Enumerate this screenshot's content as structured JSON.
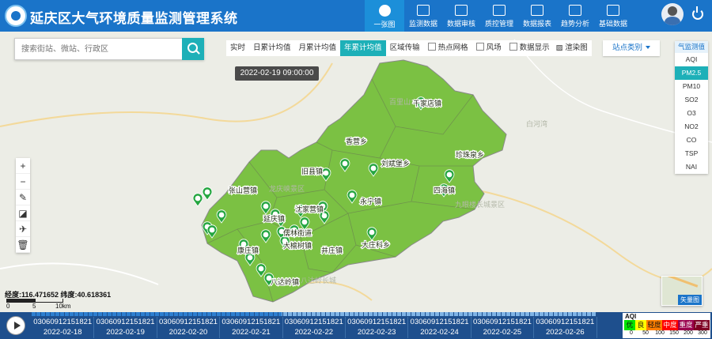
{
  "header": {
    "title": "延庆区大气环境质量监测管理系统",
    "nav": [
      {
        "label": "一张图",
        "icon": "globe-icon",
        "active": true
      },
      {
        "label": "监测数据",
        "icon": "monitor-icon"
      },
      {
        "label": "数据审核",
        "icon": "audit-icon"
      },
      {
        "label": "质控管理",
        "icon": "qc-icon"
      },
      {
        "label": "数据报表",
        "icon": "report-icon"
      },
      {
        "label": "趋势分析",
        "icon": "trend-icon"
      },
      {
        "label": "基础数据",
        "icon": "database-icon"
      }
    ]
  },
  "search": {
    "placeholder": "搜索街站、微站、行政区"
  },
  "toolbar": {
    "tabs": [
      "实时",
      "日累计均值",
      "月累计均值",
      "年累计均值"
    ],
    "active_tab": "年累计均值",
    "options": [
      "区域传输",
      "热点网格",
      "风场",
      "数据显示"
    ],
    "render_label": "渲染图",
    "site_type_label": "站点类别"
  },
  "pollutants": {
    "title": "气监测值",
    "items": [
      "AQI",
      "PM2.5",
      "PM10",
      "SO2",
      "O3",
      "NO2",
      "CO",
      "TSP",
      "NAI"
    ],
    "active": "PM2.5"
  },
  "map": {
    "datetime": "2022-02-19 09:00:00",
    "coords": "经度:116.471652 纬度:40.618361",
    "scale": {
      "zero": "0",
      "mid": "5",
      "end": "10km"
    },
    "minimap_label": "矢量图",
    "district_color": "#7bc143",
    "places": [
      {
        "name": "千家店镇"
      },
      {
        "name": "珍珠泉乡"
      },
      {
        "name": "香营乡"
      },
      {
        "name": "刘斌堡乡"
      },
      {
        "name": "旧县镇"
      },
      {
        "name": "四海镇"
      },
      {
        "name": "张山营镇"
      },
      {
        "name": "永宁镇"
      },
      {
        "name": "沈家营镇"
      },
      {
        "name": "延庆镇"
      },
      {
        "name": "儒林街道"
      },
      {
        "name": "大榆树镇"
      },
      {
        "name": "井庄镇"
      },
      {
        "name": "大庄科乡"
      },
      {
        "name": "康庄镇"
      },
      {
        "name": "八达岭镇"
      }
    ],
    "background_labels": [
      "白河湾",
      "九眼楼长城景区",
      "龙庆峡景区",
      "百里山水画廊",
      "八达岭长城"
    ]
  },
  "timeline": {
    "items": [
      {
        "code": "03060912151821",
        "date": "2022-02-18"
      },
      {
        "code": "03060912151821",
        "date": "2022-02-19"
      },
      {
        "code": "03060912151821",
        "date": "2022-02-20"
      },
      {
        "code": "03060912151821",
        "date": "2022-02-21"
      },
      {
        "code": "03060912151821",
        "date": "2022-02-22"
      },
      {
        "code": "03060912151821",
        "date": "2022-02-23"
      },
      {
        "code": "03060912151821",
        "date": "2022-02-24"
      },
      {
        "code": "03060912151821",
        "date": "2022-02-25"
      },
      {
        "code": "03060912151821",
        "date": "2022-02-26"
      }
    ]
  },
  "aqi_legend": {
    "title": "AQI",
    "levels": [
      {
        "label": "优",
        "color": "#00e400"
      },
      {
        "label": "良",
        "color": "#ffff00"
      },
      {
        "label": "轻度",
        "color": "#ff7e00"
      },
      {
        "label": "中度",
        "color": "#ff0000"
      },
      {
        "label": "重度",
        "color": "#99004c"
      },
      {
        "label": "严重",
        "color": "#7e0023"
      }
    ],
    "breaks": [
      "0",
      "50",
      "100",
      "150",
      "200",
      "300"
    ]
  }
}
